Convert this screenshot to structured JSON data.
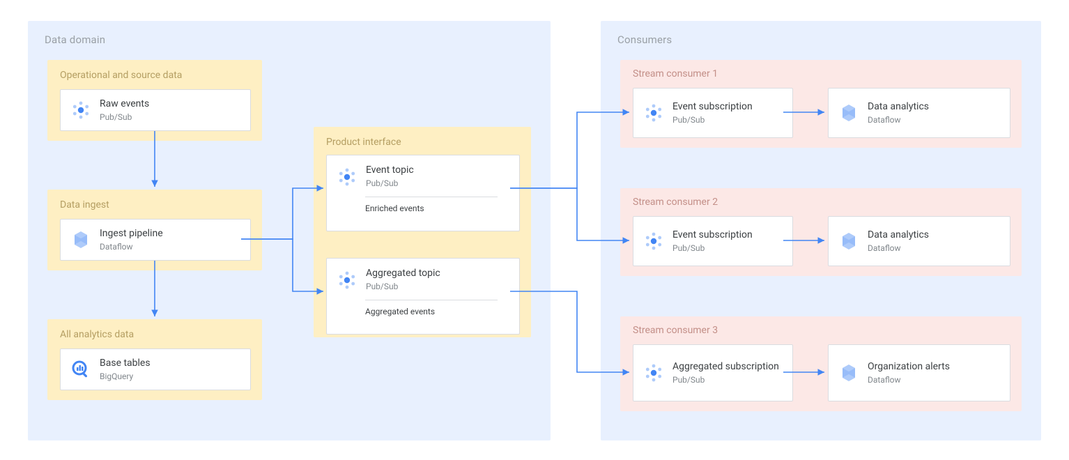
{
  "regions": {
    "domain": {
      "label": "Data domain"
    },
    "consumers": {
      "label": "Consumers"
    }
  },
  "domain": {
    "source": {
      "label": "Operational and source data",
      "raw": {
        "title": "Raw events",
        "sub": "Pub/Sub"
      }
    },
    "ingest": {
      "label": "Data ingest",
      "pipeline": {
        "title": "Ingest pipeline",
        "sub": "Dataflow"
      }
    },
    "analytics": {
      "label": "All analytics data",
      "base": {
        "title": "Base tables",
        "sub": "BigQuery"
      }
    },
    "interface": {
      "label": "Product interface",
      "event_topic": {
        "title": "Event topic",
        "sub": "Pub/Sub",
        "note": "Enriched events"
      },
      "agg_topic": {
        "title": "Aggregated topic",
        "sub": "Pub/Sub",
        "note": "Aggregated events"
      }
    }
  },
  "consumers": {
    "c1": {
      "label": "Stream consumer 1",
      "subscription": {
        "title": "Event subscription",
        "sub": "Pub/Sub"
      },
      "analytics": {
        "title": "Data analytics",
        "sub": "Dataflow"
      }
    },
    "c2": {
      "label": "Stream consumer 2",
      "subscription": {
        "title": "Event subscription",
        "sub": "Pub/Sub"
      },
      "analytics": {
        "title": "Data analytics",
        "sub": "Dataflow"
      }
    },
    "c3": {
      "label": "Stream consumer 3",
      "subscription": {
        "title": "Aggregated subscription",
        "sub": "Pub/Sub"
      },
      "analytics": {
        "title": "Organization alerts",
        "sub": "Dataflow"
      }
    }
  }
}
